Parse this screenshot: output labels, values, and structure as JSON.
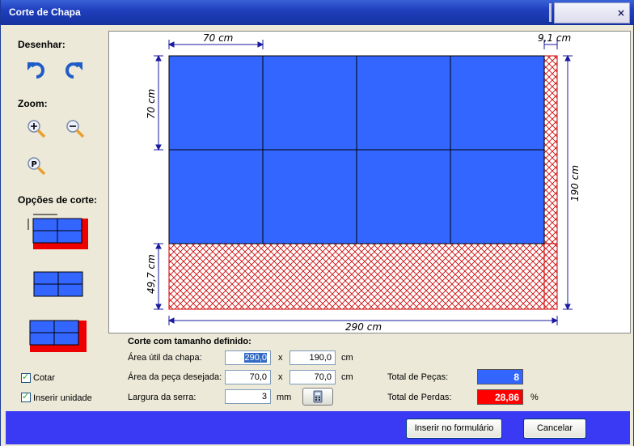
{
  "window": {
    "title": "Corte de Chapa",
    "close": "×"
  },
  "sidebar": {
    "draw_label": "Desenhar:",
    "zoom_label": "Zoom:",
    "cut_options_label": "Opções de corte:",
    "icons": [
      "undo-icon",
      "redo-icon",
      "zoom-in-icon",
      "zoom-out-icon",
      "zoom-page-icon"
    ]
  },
  "diagram": {
    "top_dim": "70 cm",
    "top_right_dim": "9,1 cm",
    "left_top_dim": "70 cm",
    "left_bottom_dim": "49,7 cm",
    "right_dim": "190 cm",
    "bottom_dim": "290 cm",
    "colors": {
      "piece": "#3366ff",
      "waste": "#cc0000"
    }
  },
  "form": {
    "section_title": "Corte com tamanho definido:",
    "sheet_label": "Área útil da chapa:",
    "sheet_w": "290,0",
    "sheet_h": "190,0",
    "piece_label": "Área da peça desejada:",
    "piece_w": "70,0",
    "piece_h": "70,0",
    "saw_label": "Largura da serra:",
    "saw_value": "3",
    "times": "x",
    "unit_cm": "cm",
    "unit_mm": "mm",
    "total_pieces_label": "Total de Peças:",
    "total_pieces": "8",
    "total_loss_label": "Total de Perdas:",
    "total_loss": "28,86",
    "percent": "%",
    "pieces_color": "#3366ff",
    "loss_color": "#ff0000"
  },
  "options": {
    "cotar_label": "Cotar",
    "insert_unit_label": "Inserir unidade"
  },
  "buttons": {
    "insert": "Inserir no formulário",
    "cancel": "Cancelar"
  }
}
